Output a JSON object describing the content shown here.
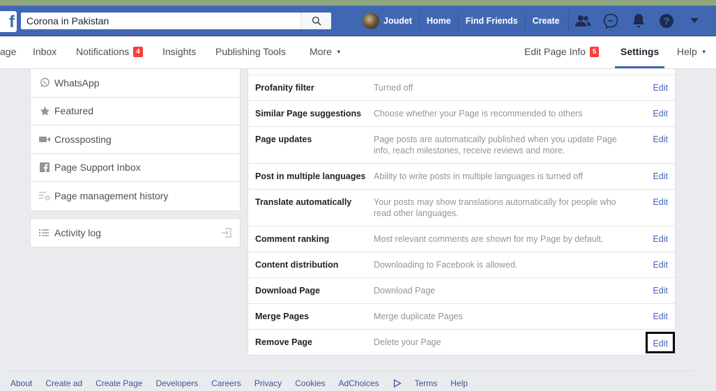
{
  "header": {
    "search_value": "Corona in Pakistan",
    "user_name": "Joudet",
    "home": "Home",
    "find_friends": "Find Friends",
    "create": "Create"
  },
  "pagebar": {
    "page_tab": "age",
    "inbox": "Inbox",
    "notifications": "Notifications",
    "notifications_count": "4",
    "insights": "Insights",
    "publishing_tools": "Publishing Tools",
    "more": "More",
    "edit_page_info": "Edit Page Info",
    "edit_page_info_count": "5",
    "settings": "Settings",
    "help": "Help"
  },
  "sidebar": {
    "items": [
      {
        "label": "WhatsApp",
        "icon": "whatsapp-icon"
      },
      {
        "label": "Featured",
        "icon": "star-icon"
      },
      {
        "label": "Crossposting",
        "icon": "video-camera-icon"
      },
      {
        "label": "Page Support Inbox",
        "icon": "facebook-square-icon"
      },
      {
        "label": "Page management history",
        "icon": "history-gear-icon"
      }
    ],
    "activity_log": "Activity log"
  },
  "settings": {
    "edit_label": "Edit",
    "rows": [
      {
        "label": "Profanity filter",
        "desc": "Turned off"
      },
      {
        "label": "Similar Page suggestions",
        "desc": "Choose whether your Page is recommended to others"
      },
      {
        "label": "Page updates",
        "desc": "Page posts are automatically published when you update Page info, reach milestones, receive reviews and more."
      },
      {
        "label": "Post in multiple languages",
        "desc": "Ability to write posts in multiple languages is turned off"
      },
      {
        "label": "Translate automatically",
        "desc": "Your posts may show translations automatically for people who read other languages."
      },
      {
        "label": "Comment ranking",
        "desc": "Most relevant comments are shown for my Page by default."
      },
      {
        "label": "Content distribution",
        "desc": "Downloading to Facebook is allowed."
      },
      {
        "label": "Download Page",
        "desc": "Download Page"
      },
      {
        "label": "Merge Pages",
        "desc": "Merge duplicate Pages"
      },
      {
        "label": "Remove Page",
        "desc": "Delete your Page"
      }
    ]
  },
  "footer": {
    "links": [
      "About",
      "Create ad",
      "Create Page",
      "Developers",
      "Careers",
      "Privacy",
      "Cookies",
      "AdChoices",
      "Terms",
      "Help"
    ]
  },
  "colors": {
    "brand_blue": "#4267b2",
    "badge_red": "#fa3e3e"
  }
}
